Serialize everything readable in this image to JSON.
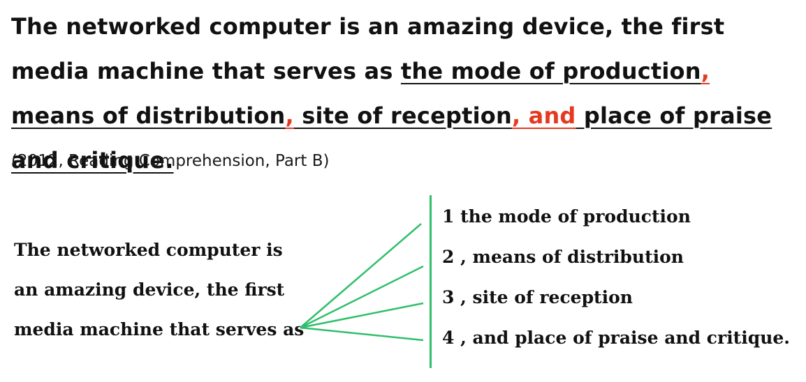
{
  "sentence": {
    "pre": "The networked computer is an amazing device, the first media machine that serves as ",
    "part1": "the mode of production",
    "comma1": ",",
    "part2": " means of distribution",
    "comma2": ",",
    "part3": " site of reception",
    "comma3": ", and",
    "part4": " place of praise and critique."
  },
  "source": "(2012, Reading Comprehension, Part B)",
  "diagram": {
    "stem": "The networked computer is an amazing device, the first media machine that serves as",
    "parts": [
      "1 the mode of production",
      "2 , means of distribution",
      "3 , site of reception",
      "4 , and place of praise and critique."
    ],
    "line_color": "#2fbf6a"
  },
  "colors": {
    "highlight": "#e53a22",
    "text": "#111111"
  }
}
